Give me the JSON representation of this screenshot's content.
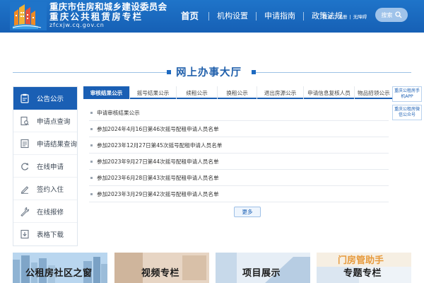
{
  "header": {
    "brand_line1": "重庆市住房和城乡建设委员会",
    "brand_line2": "重庆公共租赁房专栏",
    "brand_url": "zfcxjw.cq.gov.cn",
    "nav": [
      "首页",
      "机构设置",
      "申请指南",
      "政策法规"
    ],
    "user_links": [
      "登录",
      "注册",
      "无障碍"
    ],
    "search_label": "搜索",
    "colors": {
      "bar": "#1a68bf",
      "accent": "#1a5fb4"
    }
  },
  "section_title": "网上办事大厅",
  "sidebar": {
    "items": [
      {
        "label": "公告公示",
        "icon": "clipboard-icon",
        "active": true
      },
      {
        "label": "申请点查询",
        "icon": "document-search-icon",
        "active": false
      },
      {
        "label": "申请结果查询",
        "icon": "document-check-icon",
        "active": false
      },
      {
        "label": "在线申请",
        "icon": "refresh-icon",
        "active": false
      },
      {
        "label": "签约入住",
        "icon": "pen-icon",
        "active": false
      },
      {
        "label": "在线报修",
        "icon": "wrench-icon",
        "active": false
      },
      {
        "label": "表格下载",
        "icon": "download-icon",
        "active": false
      }
    ]
  },
  "tabs": [
    "审核结果公示",
    "摇号结果公示",
    "续租公示",
    "换租公示",
    "退出房源公示",
    "申请信息复核人员",
    "物品招领公示"
  ],
  "list": [
    "申请审核结果公示",
    "参加2024年4月16日第46次摇号配租申请人员名单",
    "参加2023年12月27日第45次摇号配租申请人员名单",
    "参加2023年9月27日第44次摇号配租申请人员名单",
    "参加2023年6月28日第43次摇号配租申请人员名单",
    "参加2023年3月29日第42次摇号配租申请人员名单"
  ],
  "more_label": "更多",
  "float_cards": [
    "重庆公租房手机APP",
    "重庆公租房微信公众号"
  ],
  "banners": [
    "公租房社区之窗",
    "视频专栏",
    "项目展示",
    "门房管助手",
    "专题专栏"
  ]
}
